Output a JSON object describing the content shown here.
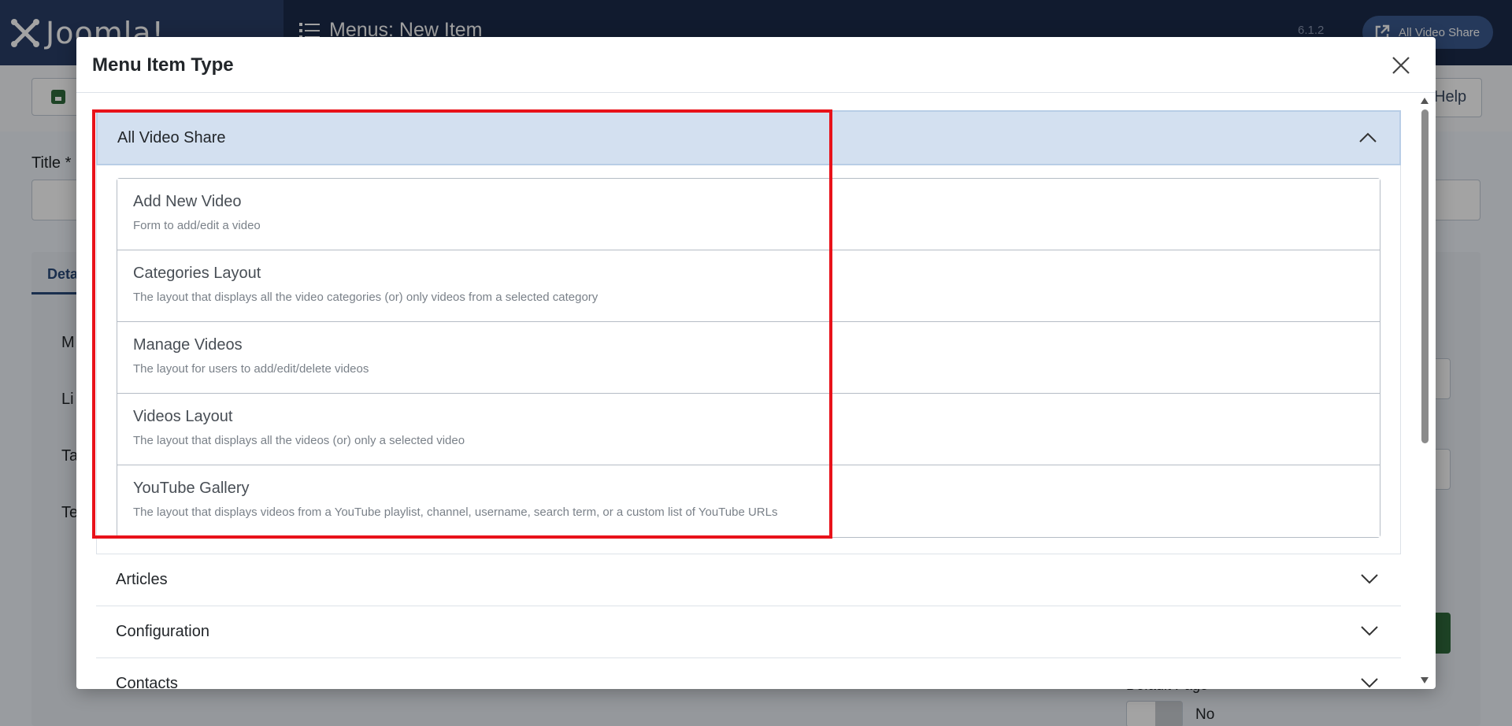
{
  "app": {
    "logo_text": "Joomla!",
    "page_title": "Menus: New Item",
    "version": "6.1.2",
    "site_button_label": "All Video Share"
  },
  "toolbar": {
    "help_label": "Help"
  },
  "form": {
    "title_label": "Title *",
    "tab_details": "Deta",
    "left_labels": [
      "M",
      "Li",
      "Ta",
      "Te"
    ],
    "default_page_label": "Default Page",
    "default_page_value": "No"
  },
  "modal": {
    "title": "Menu Item Type",
    "open_group": {
      "label": "All Video Share",
      "items": [
        {
          "title": "Add New Video",
          "desc": "Form to add/edit a video"
        },
        {
          "title": "Categories Layout",
          "desc": "The layout that displays all the video categories (or) only videos from a selected category"
        },
        {
          "title": "Manage Videos",
          "desc": "The layout for users to add/edit/delete videos"
        },
        {
          "title": "Videos Layout",
          "desc": "The layout that displays all the videos (or) only a selected video"
        },
        {
          "title": "YouTube Gallery",
          "desc": "The layout that displays videos from a YouTube playlist, channel, username, search term, or a custom list of YouTube URLs"
        }
      ]
    },
    "collapsed_groups": [
      "Articles",
      "Configuration",
      "Contacts"
    ]
  },
  "colors": {
    "header_bg": "#1c2b4a",
    "accordion_open_bg": "#d3e0f0",
    "highlight": "#e8121a"
  },
  "icons": {
    "logo": "joomla-logo-icon",
    "menu": "list-icon",
    "external": "external-link-icon",
    "save": "save-icon",
    "close": "close-icon",
    "chevron_up": "chevron-up-icon",
    "chevron_down": "chevron-down-icon"
  }
}
